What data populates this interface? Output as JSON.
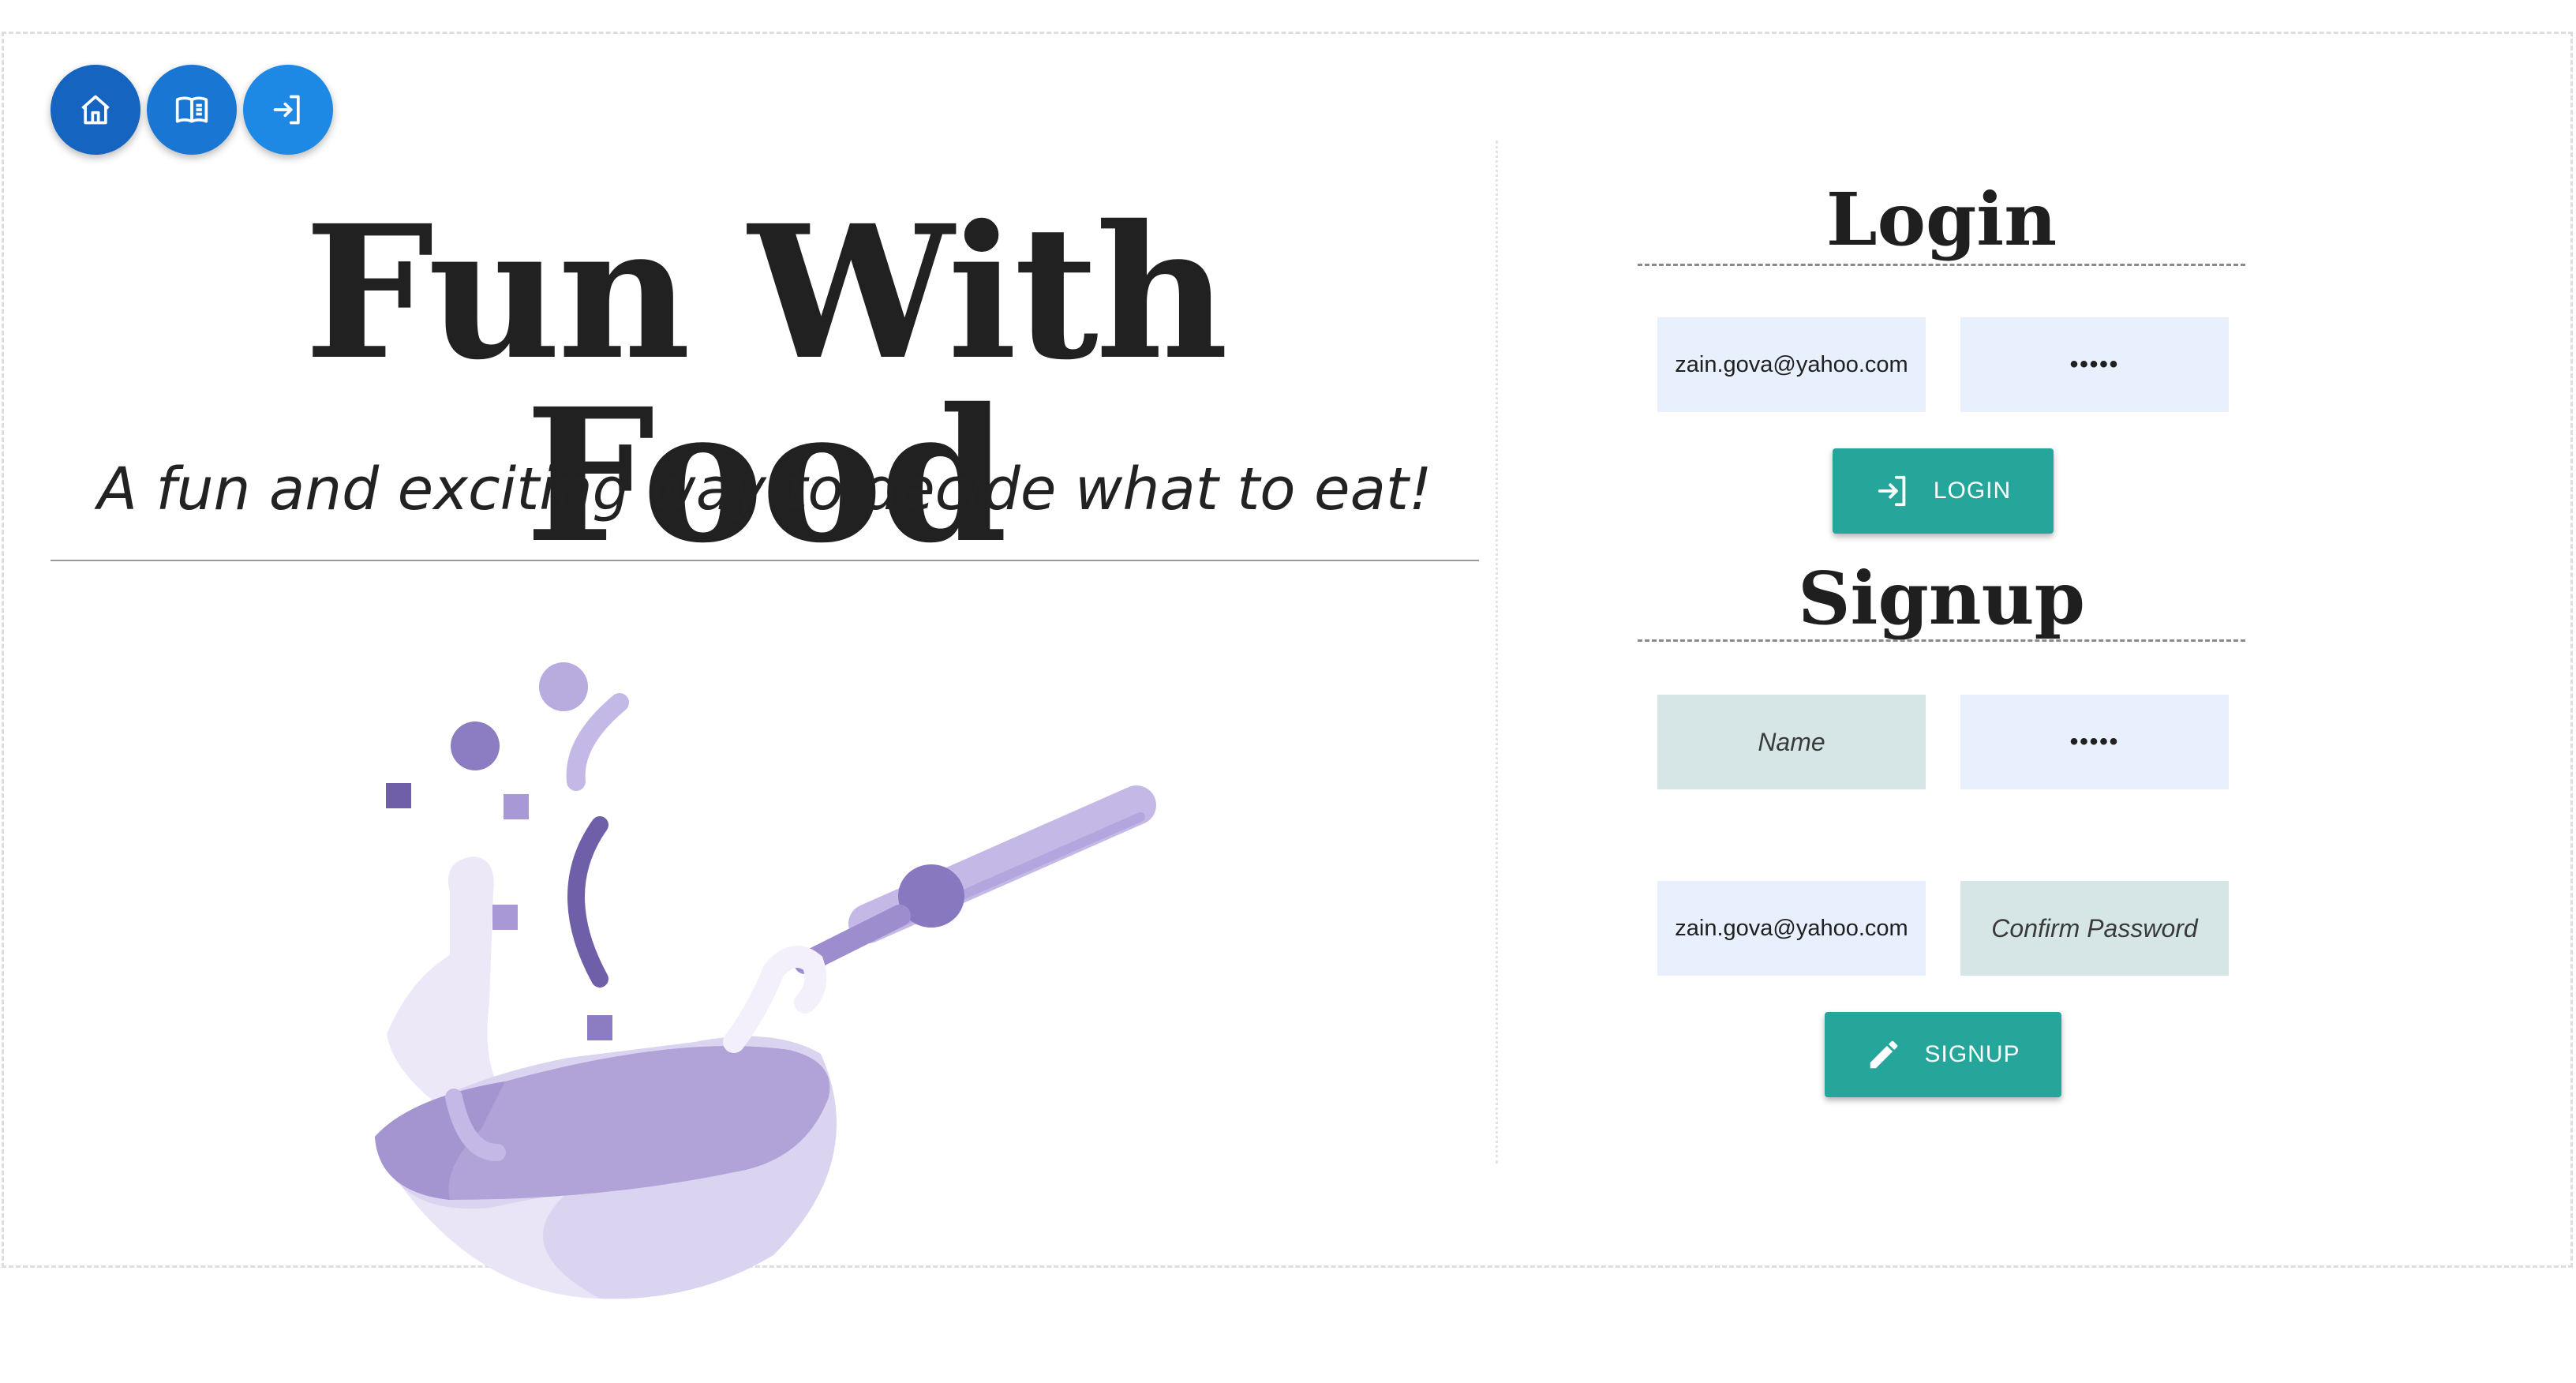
{
  "nav": {
    "buttons": [
      {
        "icon": "home-icon",
        "color": "#1565c0"
      },
      {
        "icon": "book-icon",
        "color": "#1976d2"
      },
      {
        "icon": "login-icon",
        "color": "#1e88e5"
      }
    ]
  },
  "hero": {
    "title": "Fun With Food",
    "subtitle": "A fun and exciting way to decide what to eat!",
    "illustration": "wok-with-tossed-food"
  },
  "login": {
    "title": "Login",
    "email_value": "zain.gova@yahoo.com",
    "password_value": "•••••",
    "button_label": "LOGIN",
    "button_icon": "login-icon"
  },
  "signup": {
    "title": "Signup",
    "name_placeholder": "Name",
    "password_value": "•••••",
    "email_value": "zain.gova@yahoo.com",
    "confirm_placeholder": "Confirm Password",
    "button_label": "SIGNUP",
    "button_icon": "pencil-icon"
  },
  "colors": {
    "accent": "#26a69a",
    "nav_blue": "#1976d2",
    "field_filled": "#e8f0fe",
    "field_empty": "#d6e6e7",
    "illustration": "#b1a3d8"
  }
}
